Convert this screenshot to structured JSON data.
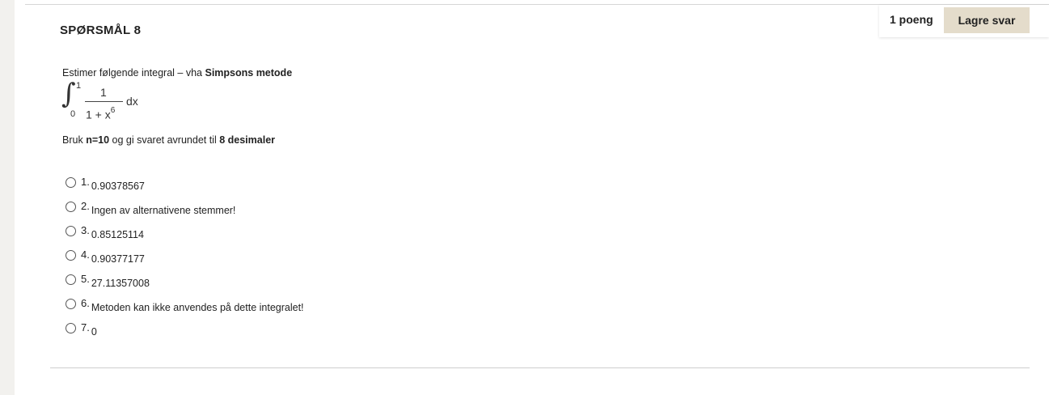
{
  "question": {
    "title": "SPØRSMÅL 8",
    "points_label": "1 poeng",
    "save_label": "Lagre svar"
  },
  "prompt": {
    "text_before": "Estimer følgende integral – vha ",
    "text_bold": "Simpsons metode"
  },
  "integral": {
    "sign": "∫",
    "upper": "1",
    "lower": "0",
    "numerator": "1",
    "denominator_base": "1 + x",
    "denominator_exp": "6",
    "differential": "dx"
  },
  "instruction": {
    "part1": "Bruk ",
    "bold1": "n=10",
    "part2": " og gi svaret avrundet til ",
    "bold2": "8 desimaler"
  },
  "options": [
    {
      "number": "1.",
      "text": "0.90378567"
    },
    {
      "number": "2.",
      "text": "Ingen av alternativene stemmer!"
    },
    {
      "number": "3.",
      "text": "0.85125114"
    },
    {
      "number": "4.",
      "text": "0.90377177"
    },
    {
      "number": "5.",
      "text": "27.11357008"
    },
    {
      "number": "6.",
      "text": "Metoden kan ikke anvendes på dette integralet!"
    },
    {
      "number": "7.",
      "text": "0"
    }
  ]
}
